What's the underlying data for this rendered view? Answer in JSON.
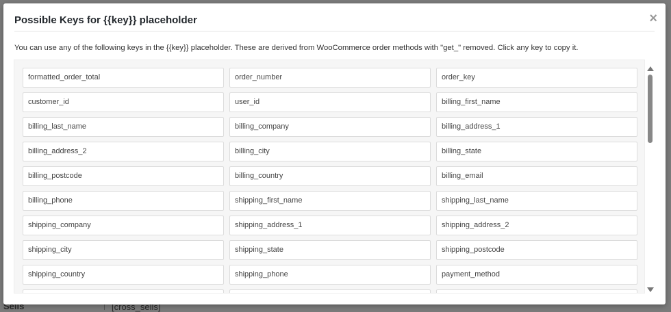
{
  "background": {
    "left_label": "Sells",
    "cell_text": "[cross_sells]"
  },
  "modal": {
    "title": "Possible Keys for {{key}} placeholder",
    "close_icon": "×",
    "description": "You can use any of the following keys in the {{key}} placeholder. These are derived from WooCommerce order methods with \"get_\" removed. Click any key to copy it.",
    "keys": [
      "formatted_order_total",
      "order_number",
      "order_key",
      "customer_id",
      "user_id",
      "billing_first_name",
      "billing_last_name",
      "billing_company",
      "billing_address_1",
      "billing_address_2",
      "billing_city",
      "billing_state",
      "billing_postcode",
      "billing_country",
      "billing_email",
      "billing_phone",
      "shipping_first_name",
      "shipping_last_name",
      "shipping_company",
      "shipping_address_1",
      "shipping_address_2",
      "shipping_city",
      "shipping_state",
      "shipping_postcode",
      "shipping_country",
      "shipping_phone",
      "payment_method",
      "",
      "",
      ""
    ]
  }
}
